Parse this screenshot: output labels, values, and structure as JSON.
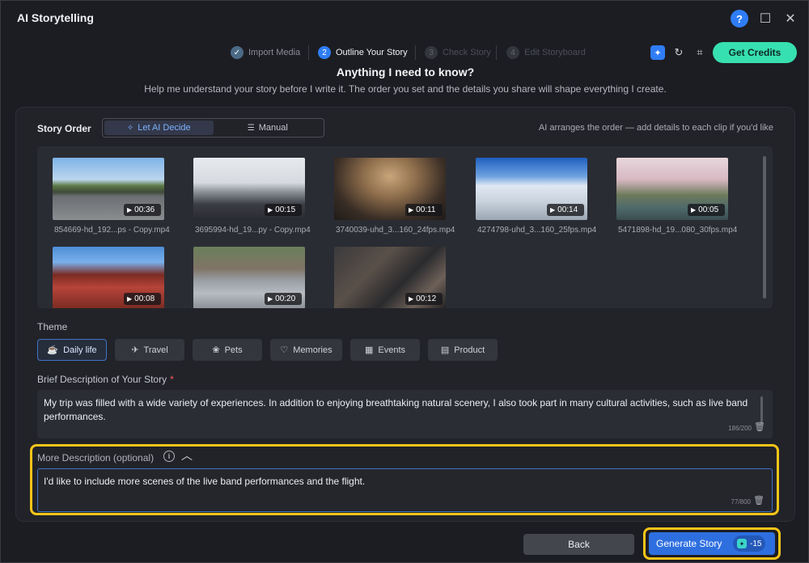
{
  "window": {
    "title": "AI Storytelling"
  },
  "titlebar_icons": {
    "help": "?",
    "maximize": "☐",
    "close": "✕"
  },
  "steps": [
    {
      "num": "✓",
      "label": "Import Media",
      "state": "done"
    },
    {
      "num": "2",
      "label": "Outline Your Story",
      "state": "active"
    },
    {
      "num": "3",
      "label": "Check Story",
      "state": "future"
    },
    {
      "num": "4",
      "label": "Edit Storyboard",
      "state": "future"
    }
  ],
  "top_actions": {
    "ai_badge": "✦",
    "refresh": "↻",
    "gift": "⌗",
    "credits_label": "Get Credits"
  },
  "header": {
    "title": "Anything I need to know?",
    "subtitle": "Help me understand your story before I write it. The order you set and the details you share will shape everything I create."
  },
  "story_order": {
    "label": "Story Order",
    "options": [
      "Let AI Decide",
      "Manual"
    ],
    "selected": "Let AI Decide",
    "hint": "AI arranges the order — add details to each clip if you'd like"
  },
  "clips": [
    {
      "duration": "00:36",
      "filename": "854669-hd_192...ps - Copy.mp4"
    },
    {
      "duration": "00:15",
      "filename": "3695994-hd_19...py - Copy.mp4"
    },
    {
      "duration": "00:11",
      "filename": "3740039-uhd_3...160_24fps.mp4"
    },
    {
      "duration": "00:14",
      "filename": "4274798-uhd_3...160_25fps.mp4"
    },
    {
      "duration": "00:05",
      "filename": "5471898-hd_19...080_30fps.mp4"
    },
    {
      "duration": "00:08",
      "filename": ""
    },
    {
      "duration": "00:20",
      "filename": ""
    },
    {
      "duration": "00:12",
      "filename": ""
    }
  ],
  "theme": {
    "label": "Theme",
    "options": [
      "Daily life",
      "Travel",
      "Pets",
      "Memories",
      "Events",
      "Product"
    ],
    "selected": "Daily life"
  },
  "brief": {
    "label": "Brief Description of Your Story",
    "required_mark": "*",
    "value": "My trip was filled with a wide variety of experiences. In addition to enjoying breathtaking natural scenery, I also took part in many cultural activities, such as live band performances.",
    "counter": "186/200"
  },
  "more": {
    "label": "More Description (optional)",
    "value": "I'd like to include more scenes of the live band performances and the flight.",
    "counter": "77/800"
  },
  "footer": {
    "back_label": "Back",
    "generate_label": "Generate Story",
    "generate_cost": "-15"
  },
  "colors": {
    "accent": "#2f7df6",
    "highlight": "#f6c518",
    "credits": "#37e0b0"
  }
}
